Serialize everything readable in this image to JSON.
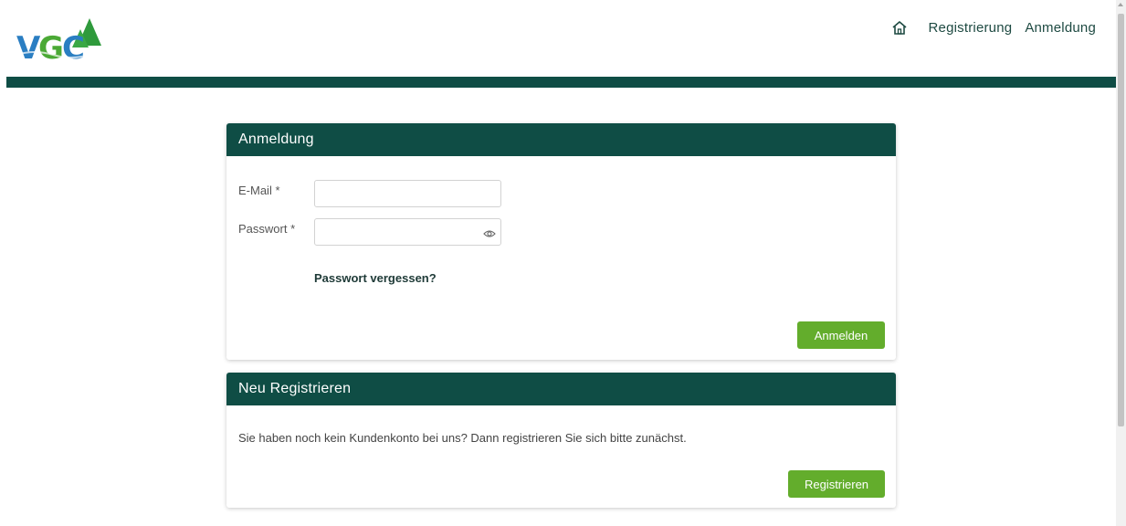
{
  "header": {
    "logo_text": "VGC",
    "nav": {
      "home_icon": "home-icon",
      "registration": "Registrierung",
      "login": "Anmeldung"
    }
  },
  "login": {
    "title": "Anmeldung",
    "email_label": "E-Mail *",
    "email_value": "",
    "password_label": "Passwort *",
    "password_value": "",
    "show_password_icon": "eye-icon",
    "forgot_password": "Passwort vergessen?",
    "submit": "Anmelden"
  },
  "register": {
    "title": "Neu Registrieren",
    "text": "Sie haben noch kein Kundenkonto bei uns? Dann registrieren Sie sich bitte zunächst.",
    "button": "Registrieren"
  },
  "colors": {
    "brand_dark_green": "#0f4d45",
    "button_green": "#63ad2c",
    "logo_blue": "#2a7ec2",
    "logo_green": "#4ba935",
    "tree_green": "#2f9a3c"
  }
}
